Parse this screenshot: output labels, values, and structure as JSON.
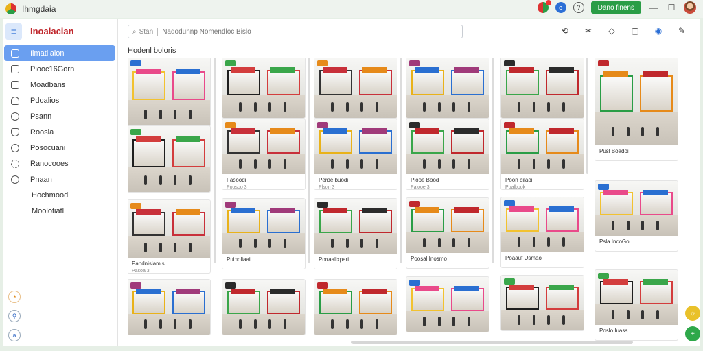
{
  "window": {
    "title": "Ihmgdaia"
  },
  "titlebar": {
    "button_label": "Dano finens"
  },
  "sidebar": {
    "brand": "Inoalacian",
    "items": [
      {
        "label": "Ilmatilaion",
        "icon": "home-icon",
        "active": true
      },
      {
        "label": "Piooc16Gorn",
        "icon": "document-icon"
      },
      {
        "label": "Moadbans",
        "icon": "calendar-icon"
      },
      {
        "label": "Pdoalios",
        "icon": "tag-icon"
      },
      {
        "label": "Psann",
        "icon": "user-icon"
      },
      {
        "label": "Roosia",
        "icon": "shield-icon"
      },
      {
        "label": "Posocuani",
        "icon": "people-icon"
      },
      {
        "label": "Ranocooes",
        "icon": "gear-icon"
      },
      {
        "label": "Pnaan",
        "icon": "map-pin-icon"
      },
      {
        "label": "Hochmoodi",
        "icon": ""
      },
      {
        "label": "Moolotiatl",
        "icon": ""
      }
    ]
  },
  "search": {
    "label": "Stan",
    "placeholder": "Nadodunnp Nomendloc Bislo"
  },
  "main": {
    "section_title": "Hodenl boloris"
  },
  "cards": [
    {
      "col": 0,
      "caption": "",
      "sub": ""
    },
    {
      "col": 0,
      "caption": "",
      "sub": ""
    },
    {
      "col": 0,
      "caption": "Pandnisiamls",
      "sub": "Pasoa 3"
    },
    {
      "col": 0,
      "caption": "",
      "sub": ""
    },
    {
      "col": 1,
      "caption": "",
      "sub": ""
    },
    {
      "col": 1,
      "caption": "Fasoodi",
      "sub": "Poosoo 3"
    },
    {
      "col": 1,
      "caption": "Puinoliaail",
      "sub": ""
    },
    {
      "col": 1,
      "caption": "",
      "sub": ""
    },
    {
      "col": 2,
      "caption": "",
      "sub": ""
    },
    {
      "col": 2,
      "caption": "Perde buodi",
      "sub": "Plson 3"
    },
    {
      "col": 2,
      "caption": "Ponaalixpari",
      "sub": ""
    },
    {
      "col": 2,
      "caption": "",
      "sub": ""
    },
    {
      "col": 3,
      "caption": "",
      "sub": ""
    },
    {
      "col": 3,
      "caption": "Plooe Bood",
      "sub": "Palooe 3"
    },
    {
      "col": 3,
      "caption": "Poosal Inosmo",
      "sub": ""
    },
    {
      "col": 3,
      "caption": "",
      "sub": ""
    },
    {
      "col": 4,
      "caption": "",
      "sub": ""
    },
    {
      "col": 4,
      "caption": "Poon bilaoi",
      "sub": "Poalbook"
    },
    {
      "col": 4,
      "caption": "Poaauf Usmao",
      "sub": ""
    },
    {
      "col": 4,
      "caption": "",
      "sub": ""
    },
    {
      "col": 5,
      "caption": "Pusl Boadoi",
      "sub": ""
    },
    {
      "col": 5,
      "caption": "Psla IncoGo",
      "sub": ""
    },
    {
      "col": 5,
      "caption": "Poslo Iuass",
      "sub": ""
    }
  ],
  "colors": {
    "accent": "#2a9d46",
    "active_nav": "#6a9ff0",
    "brand_red": "#c0282d"
  }
}
